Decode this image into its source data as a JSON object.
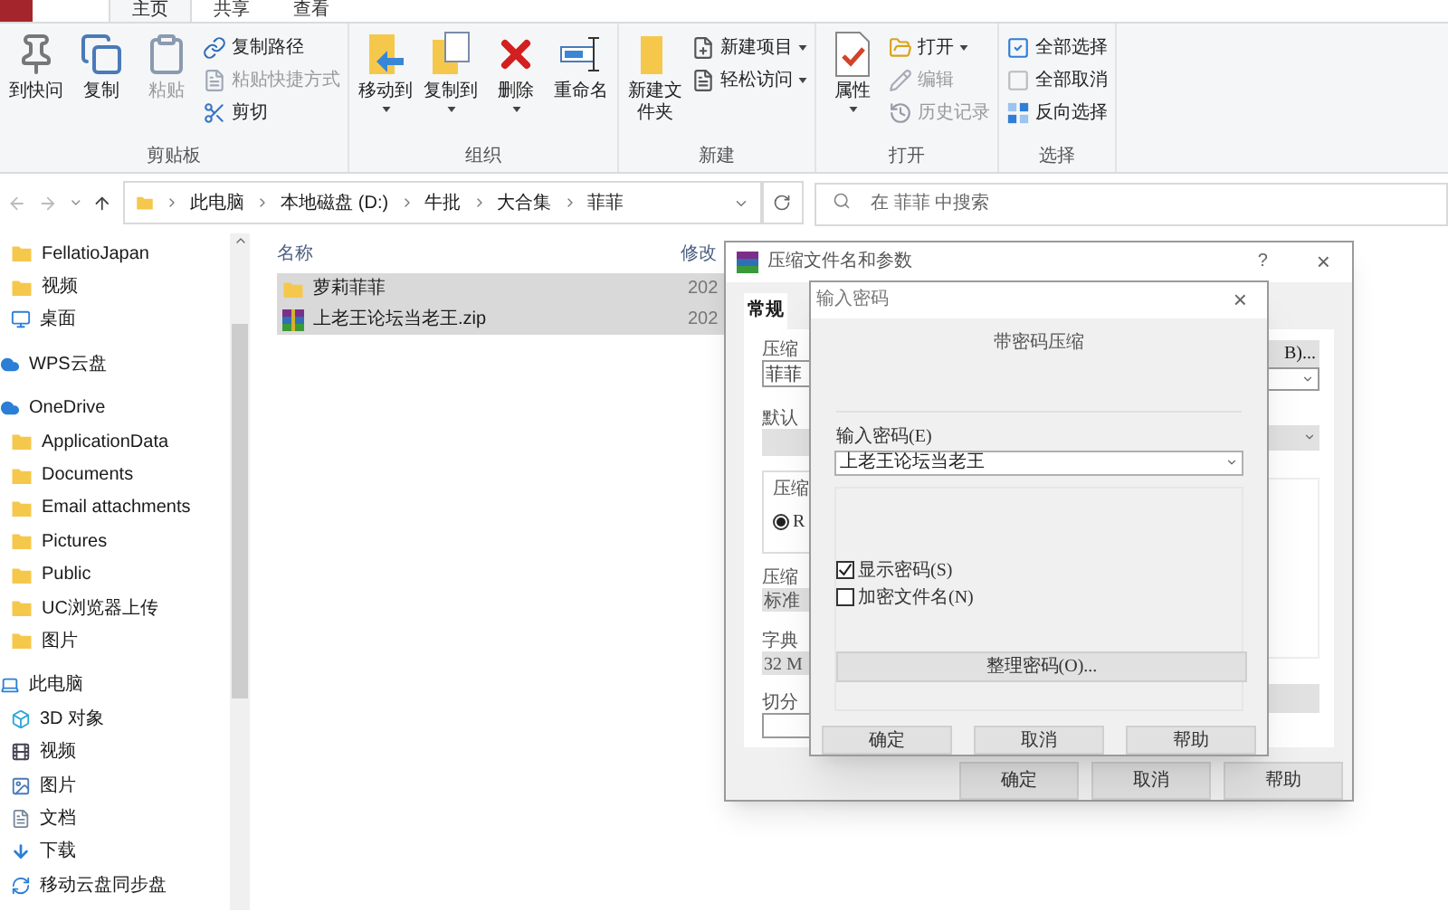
{
  "menu_tabs": [
    {
      "label": "主页",
      "selected": true
    },
    {
      "label": "共享",
      "selected": false
    },
    {
      "label": "查看",
      "selected": false
    }
  ],
  "ribbon": [
    {
      "label": "剪贴板",
      "large": [
        {
          "kind": "pin",
          "label": "到快问",
          "disabled": false,
          "dropdown": false
        },
        {
          "kind": "copy",
          "label": "复制",
          "disabled": false,
          "dropdown": false
        },
        {
          "kind": "paste",
          "label": "粘贴",
          "disabled": true,
          "dropdown": false
        }
      ],
      "small": [
        {
          "kind": "copy-path",
          "label": "复制路径",
          "disabled": false,
          "dropdown": false
        },
        {
          "kind": "paste-shortcut",
          "label": "粘贴快捷方式",
          "disabled": true,
          "dropdown": false
        },
        {
          "kind": "cut",
          "label": "剪切",
          "disabled": false,
          "dropdown": false
        }
      ]
    },
    {
      "label": "组织",
      "large": [
        {
          "kind": "move",
          "label": "移动到",
          "disabled": false,
          "dropdown": true
        },
        {
          "kind": "copy-to",
          "label": "复制到",
          "disabled": false,
          "dropdown": true
        },
        {
          "kind": "delete",
          "label": "删除",
          "disabled": false,
          "dropdown": true
        },
        {
          "kind": "rename",
          "label": "重命名",
          "disabled": false,
          "dropdown": false
        }
      ]
    },
    {
      "label": "新建",
      "large": [
        {
          "kind": "new-folder",
          "label": "新建文件夹",
          "disabled": false,
          "dropdown": false
        }
      ],
      "small": [
        {
          "kind": "new-item",
          "label": "新建项目",
          "disabled": false,
          "dropdown": true
        },
        {
          "kind": "easy-access",
          "label": "轻松访问",
          "disabled": false,
          "dropdown": true
        }
      ]
    },
    {
      "label": "打开",
      "large": [
        {
          "kind": "properties",
          "label": "属性",
          "disabled": false,
          "dropdown": true
        }
      ],
      "small": [
        {
          "kind": "open",
          "label": "打开",
          "disabled": false,
          "dropdown": true
        },
        {
          "kind": "edit",
          "label": "编辑",
          "disabled": true,
          "dropdown": false
        },
        {
          "kind": "history",
          "label": "历史记录",
          "disabled": true,
          "dropdown": false
        }
      ]
    },
    {
      "label": "选择",
      "small": [
        {
          "kind": "select-all",
          "label": "全部选择",
          "disabled": false,
          "dropdown": false
        },
        {
          "kind": "select-none",
          "label": "全部取消",
          "disabled": false,
          "dropdown": false
        },
        {
          "kind": "invert",
          "label": "反向选择",
          "disabled": false,
          "dropdown": false
        }
      ]
    }
  ],
  "address_bar": {
    "breadcrumbs": [
      "此电脑",
      "本地磁盘 (D:)",
      "牛批",
      "大合集",
      "菲菲"
    ],
    "search": {
      "placeholder": "在 菲菲 中搜索"
    }
  },
  "sidebar": {
    "quick_access_tail": [
      {
        "label": "FellatioJapan",
        "kind": "folder"
      },
      {
        "label": "视频",
        "kind": "folder"
      },
      {
        "label": "桌面",
        "kind": "desktop"
      }
    ],
    "items": [
      {
        "label": "WPS云盘",
        "kind": "cloud"
      },
      {
        "label": "OneDrive",
        "kind": "cloud",
        "children": [
          {
            "label": "ApplicationData",
            "kind": "folder"
          },
          {
            "label": "Documents",
            "kind": "folder"
          },
          {
            "label": "Email attachments",
            "kind": "folder"
          },
          {
            "label": "Pictures",
            "kind": "folder"
          },
          {
            "label": "Public",
            "kind": "folder"
          },
          {
            "label": "UC浏览器上传",
            "kind": "folder"
          },
          {
            "label": "图片",
            "kind": "folder"
          }
        ]
      },
      {
        "label": "此电脑",
        "kind": "pc",
        "children": [
          {
            "label": "3D 对象",
            "kind": "cube"
          },
          {
            "label": "视频",
            "kind": "video"
          },
          {
            "label": "图片",
            "kind": "image"
          },
          {
            "label": "文档",
            "kind": "document"
          },
          {
            "label": "下载",
            "kind": "download"
          },
          {
            "label": "移动云盘同步盘",
            "kind": "sync"
          }
        ]
      }
    ]
  },
  "file_list": {
    "columns": [
      "名称",
      "修改"
    ],
    "rows": [
      {
        "name": "萝莉菲菲",
        "kind": "folder",
        "date": "202",
        "selected": true
      },
      {
        "name": "上老王论坛当老王.zip",
        "kind": "archive",
        "date": "202",
        "selected": true
      }
    ]
  },
  "archive_dialog": {
    "title": "压缩文件名和参数",
    "help": "?",
    "close": "×",
    "tab": "常规",
    "labels": [
      "压缩",
      "默认",
      "压缩",
      "字典",
      "切分"
    ],
    "archive_name": "菲菲",
    "group_label": "压缩",
    "format_radio": {
      "label": "R",
      "selected": true
    },
    "method": "标准",
    "dictionary": "32 M",
    "set_button": "B)...",
    "buttons": [
      "确定",
      "取消",
      "帮助"
    ]
  },
  "password_dialog": {
    "title": "输入密码",
    "close": "×",
    "heading": "带密码压缩",
    "password_label": "输入密码(E)",
    "password": "上老王论坛当老王",
    "options": [
      {
        "label": "显示密码(S)",
        "checked": true
      },
      {
        "label": "加密文件名(N)",
        "checked": false
      }
    ],
    "organize_button": "整理密码(O)...",
    "buttons": [
      "确定",
      "取消",
      "帮助"
    ]
  }
}
